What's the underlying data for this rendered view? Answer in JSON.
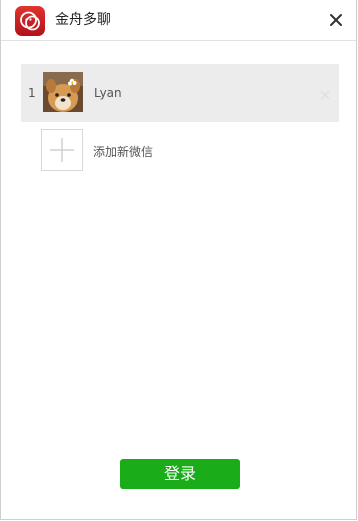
{
  "window": {
    "title": "金舟多聊",
    "logo_icon": "chat-bubbles-logo",
    "close_icon": "close-icon"
  },
  "accounts": [
    {
      "index": "1",
      "name": "Lyan",
      "avatar_icon": "dog-avatar",
      "remove_icon": "close-icon"
    }
  ],
  "add_account": {
    "label": "添加新微信",
    "icon": "plus-icon"
  },
  "login": {
    "label": "登录"
  },
  "colors": {
    "brand": "#d11f26",
    "login_button": "#1aad19",
    "selected_row": "#ececec"
  }
}
